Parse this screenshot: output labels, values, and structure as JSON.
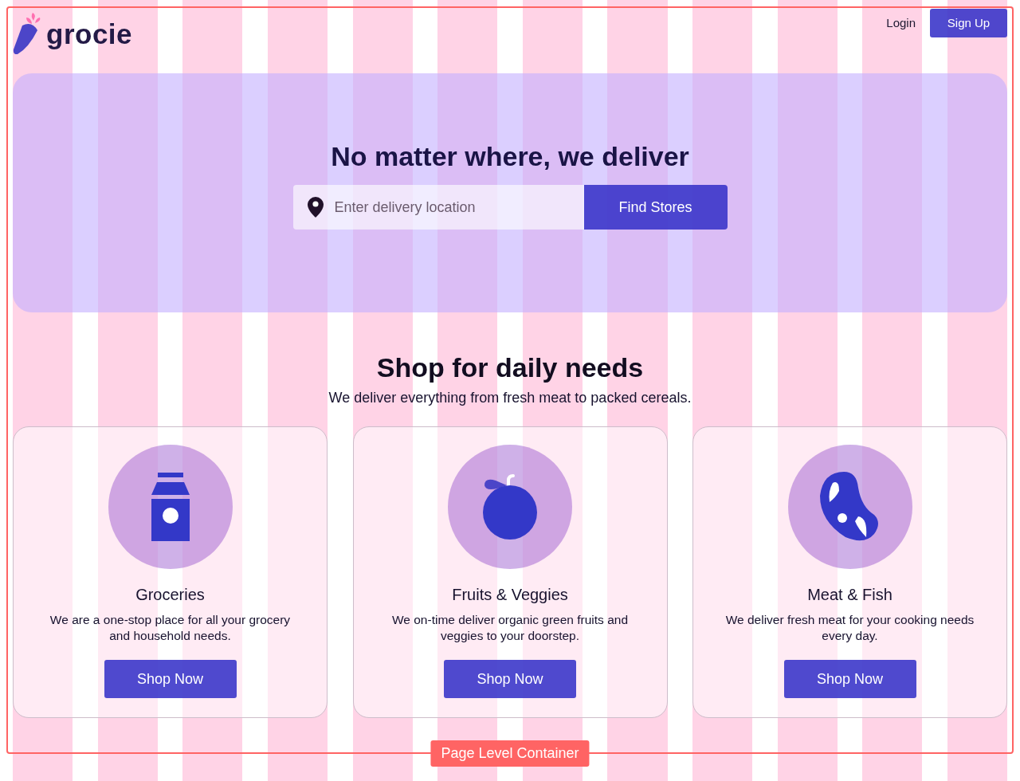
{
  "header": {
    "logo": "grocie",
    "login": "Login",
    "signup": "Sign Up"
  },
  "hero": {
    "title": "No matter where, we deliver",
    "search": {
      "placeholder": "Enter delivery location"
    },
    "button": "Find Stores"
  },
  "section": {
    "title": "Shop for daily needs",
    "subtitle": "We deliver everything from fresh meat to packed cereals."
  },
  "cards": [
    {
      "kind": "carton",
      "title": "Groceries",
      "description": "We are a one-stop place for all your grocery and household needs.",
      "button": "Shop Now"
    },
    {
      "kind": "fruit",
      "title": "Fruits & Veggies",
      "description": "We on-time deliver organic green fruits and veggies to your doorstep.",
      "button": "Shop Now"
    },
    {
      "kind": "meat",
      "title": "Meat & Fish",
      "description": "We deliver fresh meat for your cooking needs every day.",
      "button": "Shop Now"
    }
  ],
  "overlay": {
    "label": "Page Level Container"
  }
}
